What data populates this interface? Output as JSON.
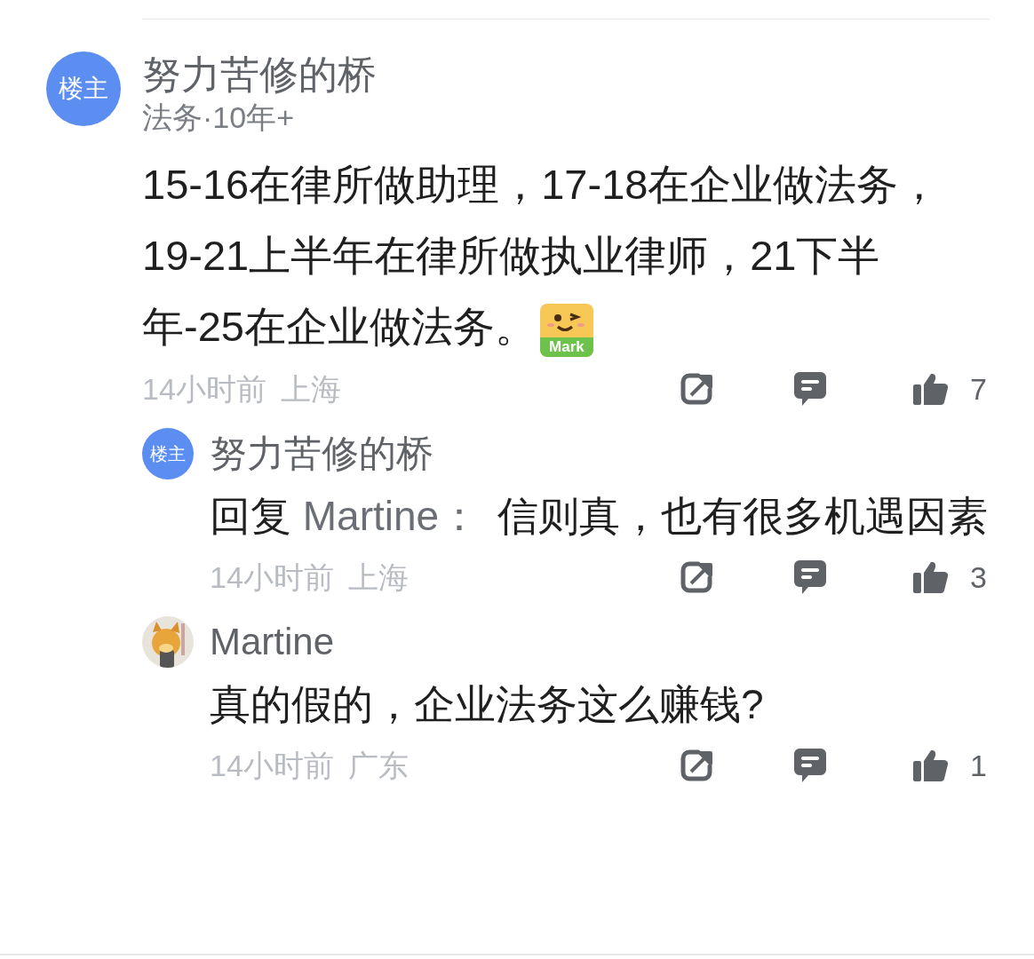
{
  "comments": [
    {
      "author": "努力苦修的桥",
      "badge": "楼主",
      "avatar": {
        "kind": "badge"
      },
      "subtitle": "法务·10年+",
      "text": "15-16在律所做助理，17-18在企业做法务，19-21上半年在律所做执业律师，21下半年-25在企业做法务。",
      "sticker": {
        "label": "Mark"
      },
      "time": "14小时前",
      "location": "上海",
      "likes": "7",
      "replies": [
        {
          "author": "努力苦修的桥",
          "badge": "楼主",
          "avatar": {
            "kind": "badge"
          },
          "reply_prefix": "回复",
          "reply_to": "Martine：",
          "text": "信则真，也有很多机遇因素",
          "time": "14小时前",
          "location": "上海",
          "likes": "3"
        },
        {
          "author": "Martine",
          "text": "真的假的，企业法务这么赚钱?",
          "time": "14小时前",
          "location": "广东",
          "likes": "1"
        }
      ]
    }
  ]
}
